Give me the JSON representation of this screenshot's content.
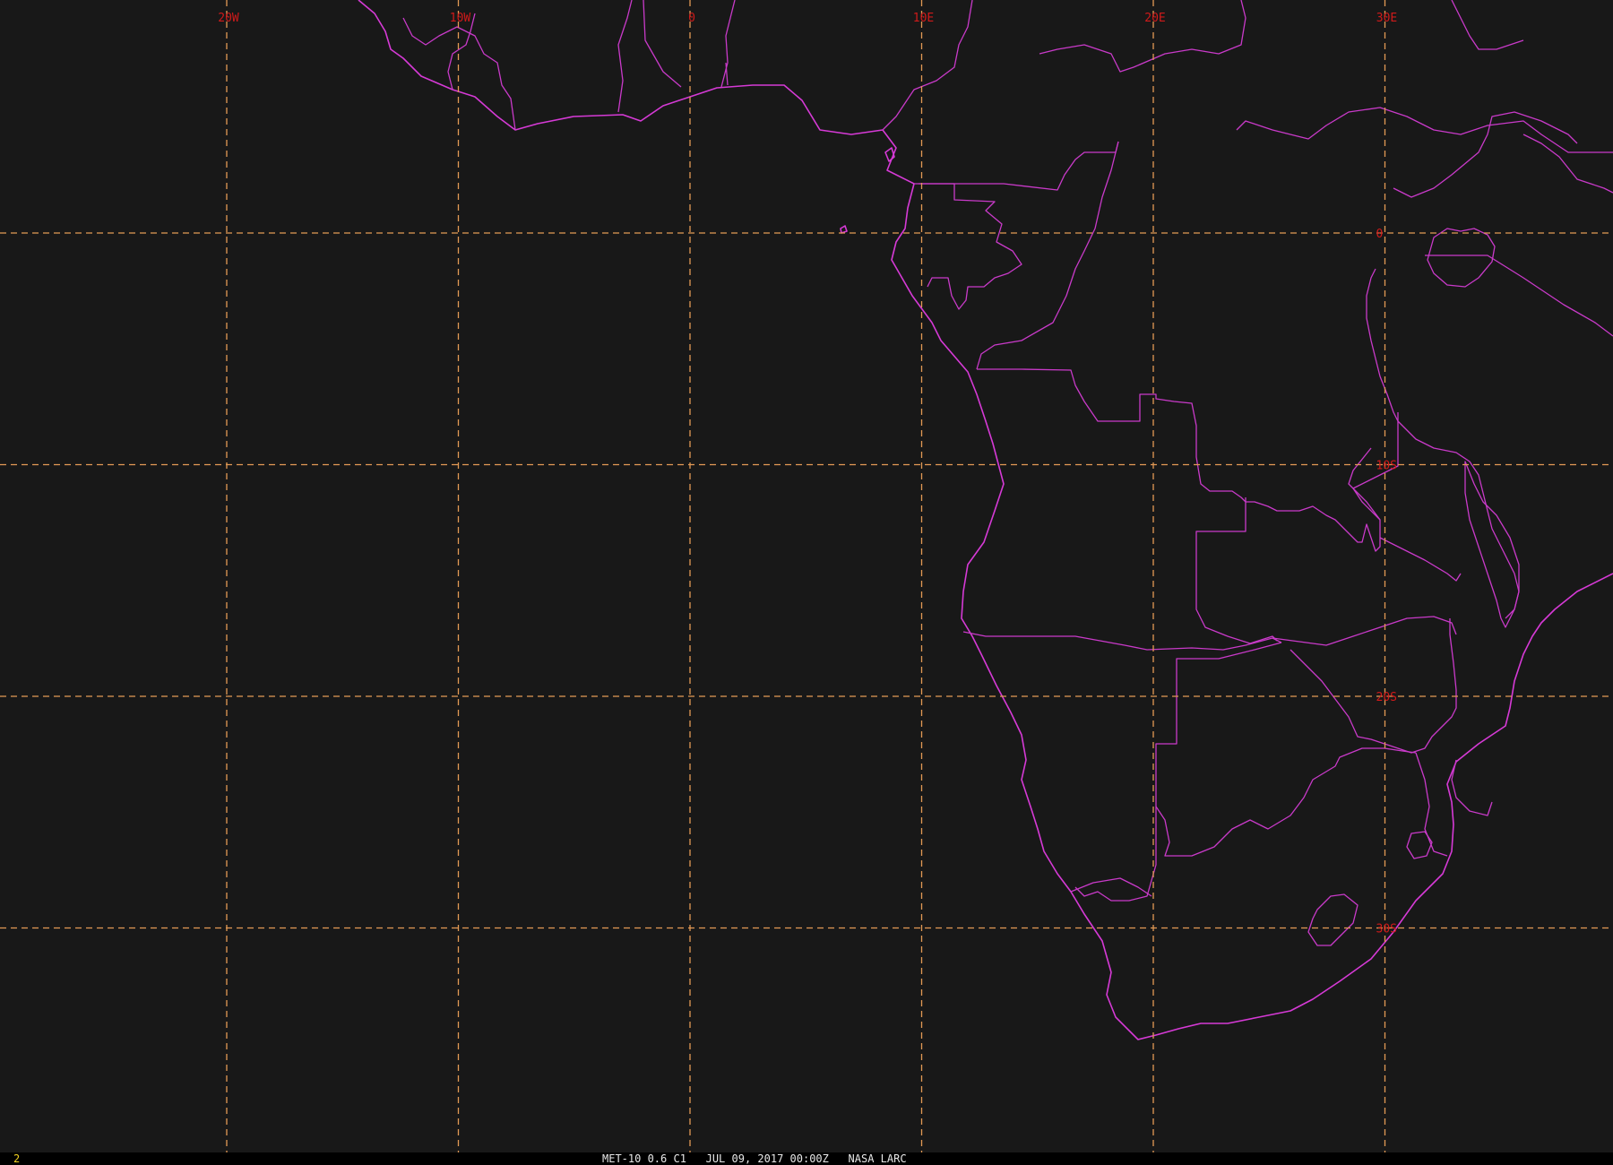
{
  "viewer": {
    "frame_number": "2",
    "caption": "MET-10 0.6 C1   JUL 09, 2017 00:00Z   NASA LARC"
  },
  "map": {
    "satellite": "MET-10",
    "channel": "0.6 C1",
    "colors": {
      "background": "#181818",
      "grid": "#e39a55",
      "grid_labels": "#d01a1a",
      "boundaries": "#d63ad6",
      "frame_number": "#f0d020"
    },
    "longitude_labels": [
      "20W",
      "10W",
      "0",
      "10E",
      "20E",
      "30E"
    ],
    "latitude_labels": [
      "0",
      "10S",
      "20S",
      "30S"
    ],
    "longitudes_deg": [
      -20,
      -10,
      0,
      10,
      20,
      30
    ],
    "latitudes_deg": [
      0,
      -10,
      -20,
      -30
    ]
  }
}
